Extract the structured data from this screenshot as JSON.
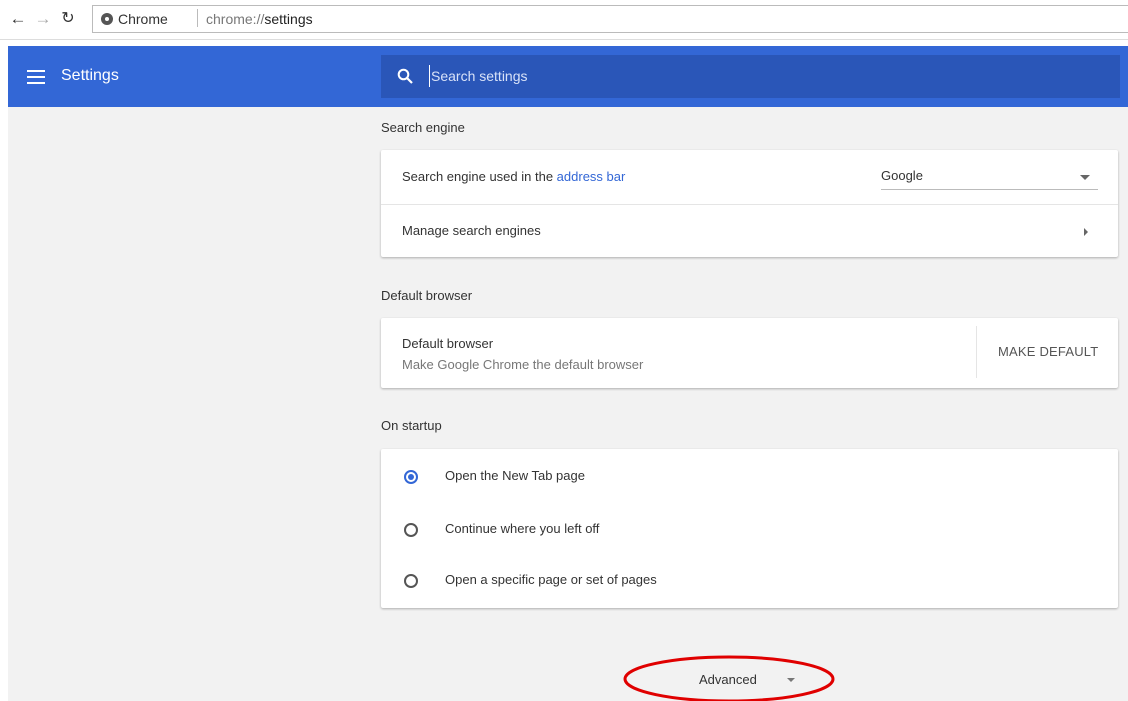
{
  "browser": {
    "site_name": "Chrome",
    "url_scheme": "chrome://",
    "url_path": "settings"
  },
  "header": {
    "title": "Settings",
    "search_placeholder": "Search settings"
  },
  "search_engine": {
    "section_title": "Search engine",
    "row_label_prefix": "Search engine used in the ",
    "row_label_link": "address bar",
    "selected_engine": "Google",
    "manage_label": "Manage search engines"
  },
  "default_browser": {
    "section_title": "Default browser",
    "title": "Default browser",
    "subtitle": "Make Google Chrome the default browser",
    "button_label": "MAKE DEFAULT"
  },
  "on_startup": {
    "section_title": "On startup",
    "options": [
      {
        "label": "Open the New Tab page",
        "checked": true
      },
      {
        "label": "Continue where you left off",
        "checked": false
      },
      {
        "label": "Open a specific page or set of pages",
        "checked": false
      }
    ]
  },
  "advanced": {
    "label": "Advanced"
  },
  "colors": {
    "accent": "#3367d6",
    "annotation": "#e00000"
  }
}
